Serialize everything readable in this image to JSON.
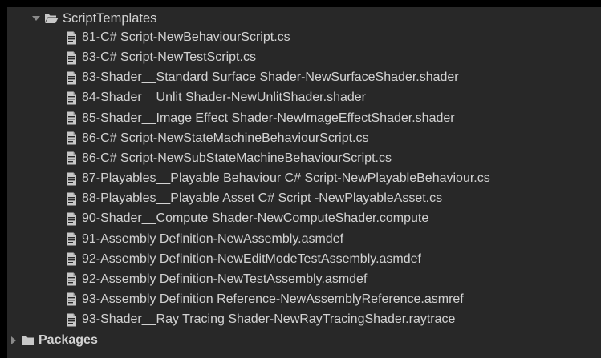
{
  "tree": {
    "root_folder": {
      "label": "ScriptTemplates",
      "expanded": true,
      "icon": "folder-open-icon"
    },
    "files": [
      "81-C# Script-NewBehaviourScript.cs",
      "83-C# Script-NewTestScript.cs",
      "83-Shader__Standard Surface Shader-NewSurfaceShader.shader",
      "84-Shader__Unlit Shader-NewUnlitShader.shader",
      "85-Shader__Image Effect Shader-NewImageEffectShader.shader",
      "86-C# Script-NewStateMachineBehaviourScript.cs",
      "86-C# Script-NewSubStateMachineBehaviourScript.cs",
      "87-Playables__Playable Behaviour C# Script-NewPlayableBehaviour.cs",
      "88-Playables__Playable Asset C# Script -NewPlayableAsset.cs",
      "90-Shader__Compute Shader-NewComputeShader.compute",
      "91-Assembly Definition-NewAssembly.asmdef",
      "92-Assembly Definition-NewEditModeTestAssembly.asmdef",
      "92-Assembly Definition-NewTestAssembly.asmdef",
      "93-Assembly Definition Reference-NewAssemblyReference.asmref",
      "93-Shader__Ray Tracing Shader-NewRayTracingShader.raytrace"
    ],
    "file_icon": "text-document-icon",
    "second_folder": {
      "label": "Packages",
      "expanded": false,
      "icon": "folder-closed-icon"
    }
  },
  "colors": {
    "panel_background": "#282828",
    "outer_background": "#000000",
    "text": "#d2d2d2",
    "arrow": "#8a8a8a",
    "icon": "#c8c8c8"
  }
}
